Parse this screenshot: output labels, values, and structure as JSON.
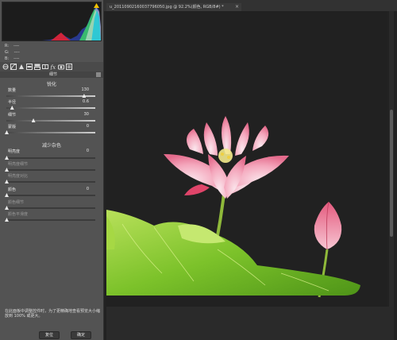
{
  "readouts": [
    {
      "key": "R:",
      "value": "----"
    },
    {
      "key": "G:",
      "value": "----"
    },
    {
      "key": "B:",
      "value": "----"
    }
  ],
  "tabs": [
    "basic-icon",
    "tone-curve-icon",
    "detail-icon",
    "hsl-icon",
    "split-toning-icon",
    "lens-icon",
    "fx-icon",
    "camera-calibration-icon",
    "presets-icon"
  ],
  "panel": {
    "title": "细节",
    "sharpen": {
      "title": "锐化",
      "controls": [
        {
          "label": "数量",
          "value": "130",
          "fraction": 0.87
        },
        {
          "label": "半径",
          "value": "0.6",
          "fraction": 0.06
        },
        {
          "label": "细节",
          "value": "30",
          "fraction": 0.3
        },
        {
          "label": "蒙版",
          "value": "0",
          "fraction": 0.0
        }
      ]
    },
    "noise": {
      "title": "减少杂色",
      "controls": [
        {
          "label": "明亮度",
          "value": "0",
          "fraction": 0.0,
          "dim": false
        },
        {
          "label": "明亮度细节",
          "value": "",
          "fraction": 0.0,
          "dim": true
        },
        {
          "label": "明亮度对比",
          "value": "",
          "fraction": 0.0,
          "dim": true
        },
        {
          "label": "颜色",
          "value": "0",
          "fraction": 0.0,
          "dim": false
        },
        {
          "label": "颜色细节",
          "value": "",
          "fraction": 0.0,
          "dim": true
        },
        {
          "label": "颜色平滑度",
          "value": "",
          "fraction": 0.0,
          "dim": true
        }
      ]
    },
    "note": "在此面板中调整控件时，为了更精确地查看预览大小缩放到 100% 或更大。"
  },
  "buttons": {
    "reset": "复位",
    "ok": "确定"
  },
  "document": {
    "tab_title": "u_2011090216003779605​0.jpg @ 92.2%(颜色, RGB/8#) *",
    "close": "×"
  },
  "colors": {
    "accent": "#f2c200",
    "panel": "#535353",
    "canvas": "#222222"
  }
}
